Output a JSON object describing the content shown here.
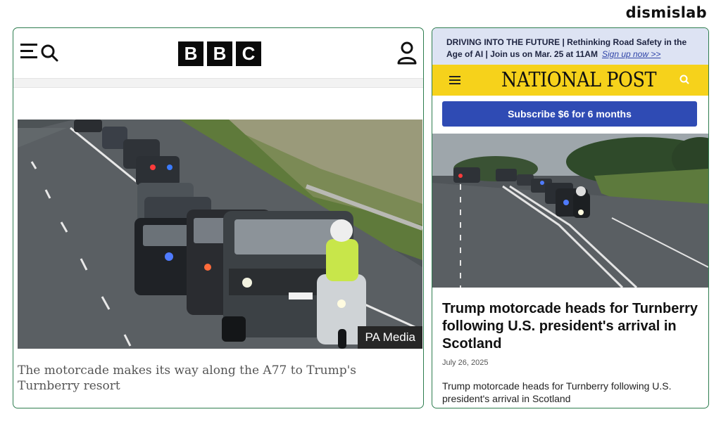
{
  "brand": "dismislab",
  "bbc": {
    "logo_letters": [
      "B",
      "B",
      "C"
    ],
    "photo_credit": "PA Media",
    "caption": "The motorcade makes its way along the A77 to Trump's Turnberry resort"
  },
  "national_post": {
    "banner_text": "DRIVING INTO THE FUTURE | Rethinking Road Safety in the Age of AI | Join us on Mar. 25 at 11AM",
    "banner_link": "Sign up now >>",
    "logo": "NATIONAL POST",
    "subscribe_label": "Subscribe $6 for 6 months",
    "headline": "Trump motorcade heads for Turnberry following U.S. president's arrival in Scotland",
    "date": "July 26, 2025",
    "summary": "Trump motorcade heads for Turnberry following U.S. president's arrival in Scotland"
  }
}
